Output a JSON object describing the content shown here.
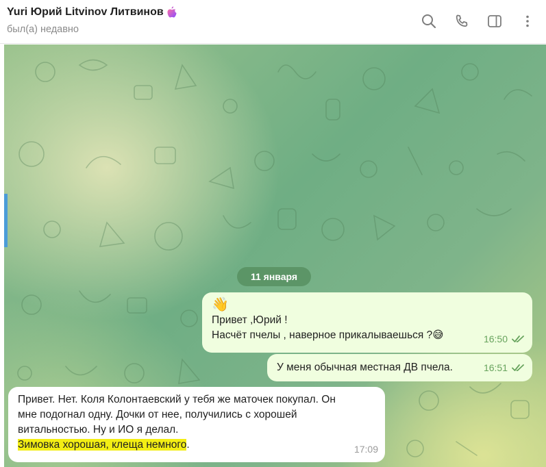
{
  "header": {
    "title": "Yuri Юрий Litvinov Литвинов",
    "status": "был(а) недавно",
    "title_icon": "apple-icon",
    "actions": [
      "search-icon",
      "phone-icon",
      "sidebar-toggle-icon",
      "more-vert-icon"
    ]
  },
  "chat": {
    "date_label": "11 января",
    "messages": [
      {
        "direction": "out",
        "lines": [
          "👋",
          "Привет ,Юрий !",
          "Насчёт пчелы , наверное прикалываешься ?"
        ],
        "trailing_emoji": "😅",
        "time": "16:50",
        "read": true
      },
      {
        "direction": "out",
        "lines": [
          "У меня обычная местная ДВ пчела."
        ],
        "time": "16:51",
        "read": true
      },
      {
        "direction": "in",
        "lines": [
          "Привет. Нет. Коля Колонтаевский у тебя же маточек покупал. Он",
          "мне подогнал одну. Дочки от нее, получились с хорошей",
          "витальностью. Ну и ИО я делал."
        ],
        "highlighted_line": "Зимовка хорошая, клеща немного",
        "highlighted_suffix": ".",
        "time": "17:09"
      }
    ]
  },
  "colors": {
    "outgoing_bubble": "#f0fedf",
    "incoming_bubble": "#ffffff",
    "check_color": "#67a35d",
    "highlight": "#f3ee14",
    "date_pill": "#548c5c"
  }
}
